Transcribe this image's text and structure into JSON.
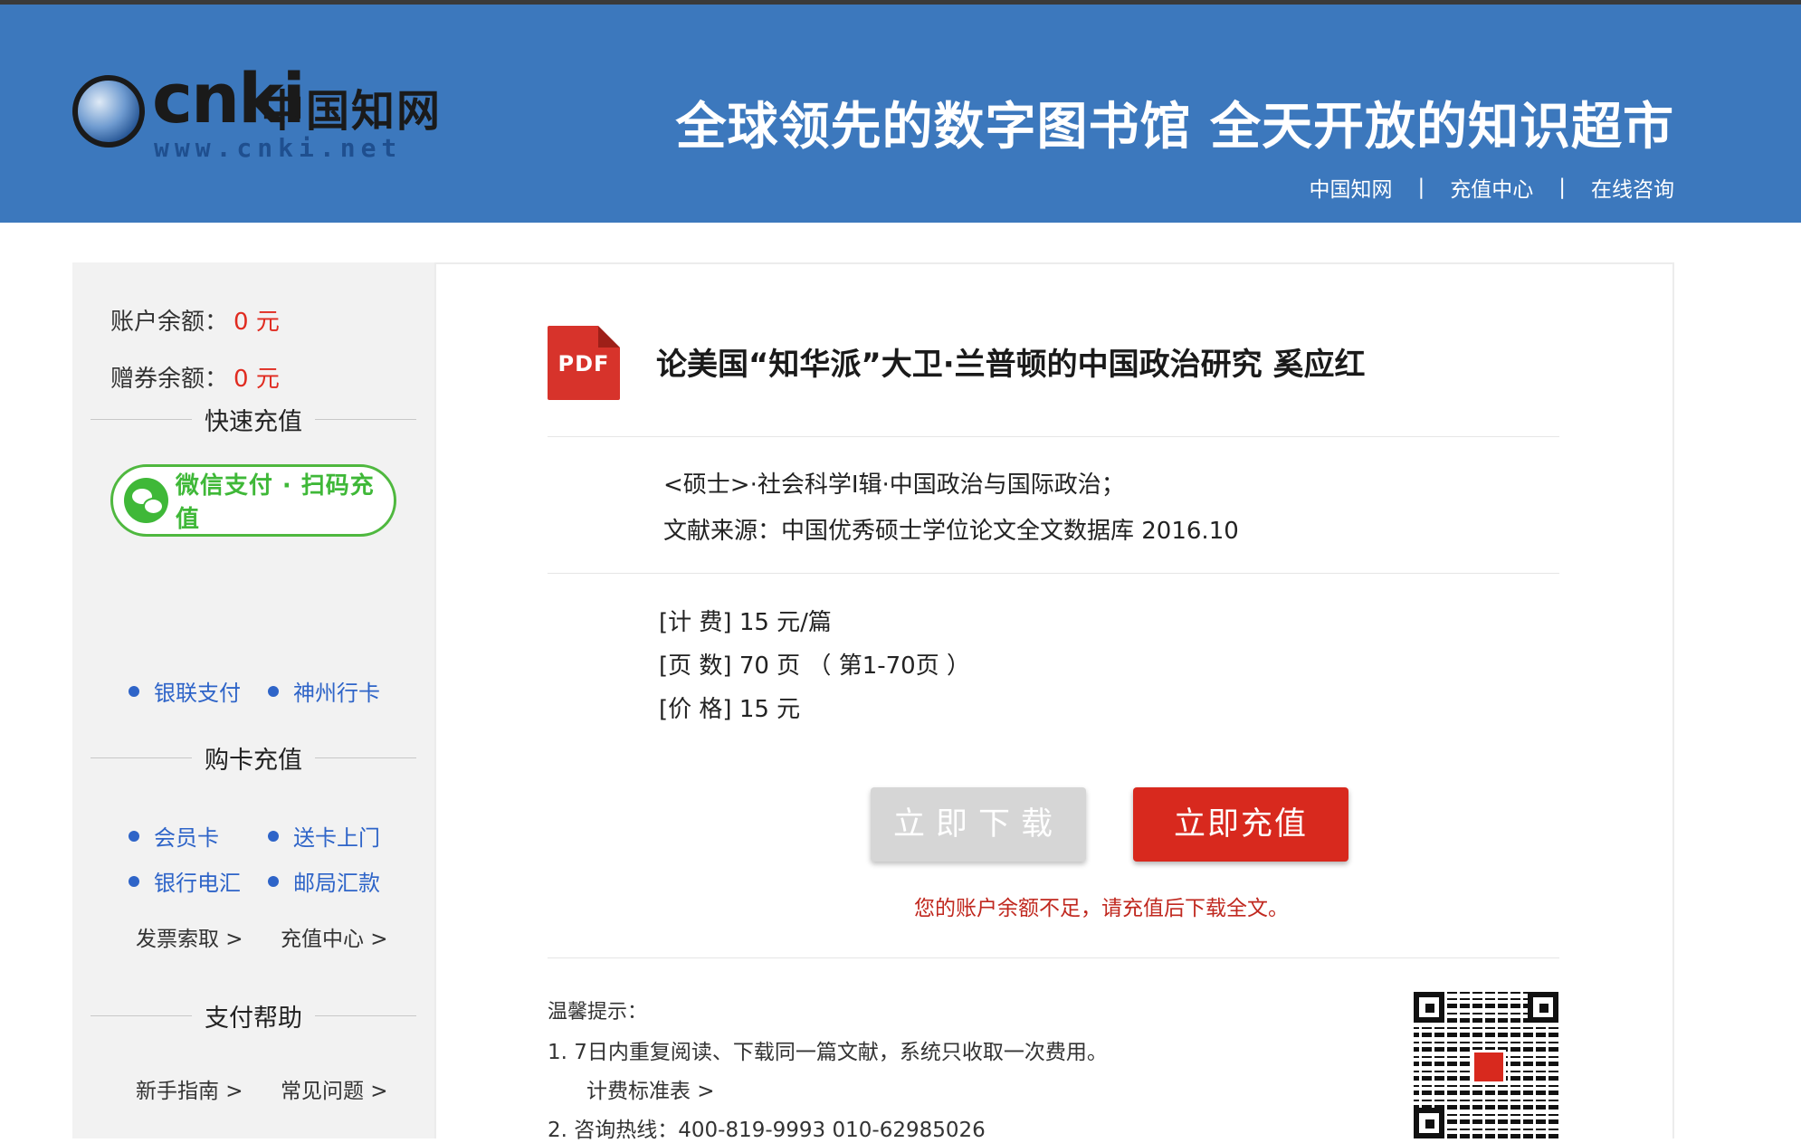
{
  "header": {
    "logo_text": "cnki",
    "logo_cn": "中国知网",
    "logo_url": "www.cnki.net",
    "slogan": "全球领先的数字图书馆 全天开放的知识超市",
    "links": [
      "中国知网",
      "充值中心",
      "在线咨询"
    ],
    "separator": "|",
    "bg_color": "#3c78bd"
  },
  "sidebar": {
    "account_balance_label": "账户余额：",
    "account_balance_value": "0 元",
    "voucher_balance_label": "赠券余额：",
    "voucher_balance_value": "0 元",
    "quick_recharge_title": "快速充值",
    "wechat_button": "微信支付 · 扫码充值",
    "quick_methods": [
      "银联支付",
      "神州行卡"
    ],
    "card_recharge_title": "购卡充值",
    "card_methods": [
      "会员卡",
      "送卡上门",
      "银行电汇",
      "邮局汇款"
    ],
    "invoice_link": "发票索取 >",
    "recharge_center_link": "充值中心 >",
    "pay_help_title": "支付帮助",
    "help_links": [
      "新手指南 >",
      "常见问题 >"
    ]
  },
  "document": {
    "icon_label": "PDF",
    "title": "论美国“知华派”大卫·兰普顿的中国政治研究 奚应红",
    "category": "<硕士>·社会科学Ⅰ辑·中国政治与国际政治；",
    "source": "文献来源：中国优秀硕士学位论文全文数据库 2016.10",
    "fee": "[计 费] 15 元/篇",
    "pages": "[页 数] 70 页 （ 第1-70页 ）",
    "price": "[价 格] 15 元"
  },
  "actions": {
    "download_button": "立即下载",
    "recharge_button": "立即充值",
    "warning": "您的账户余额不足，请充值后下载全文。"
  },
  "tips": {
    "title": "温馨提示：",
    "item1": "1.  7日内重复阅读、下载同一篇文献，系统只收取一次费用。",
    "item1_link": "计费标准表 >",
    "item2": "2.  咨询热线：400-819-9993    010-62985026"
  },
  "colors": {
    "accent_red": "#d8291e",
    "link_blue": "#2e64c8",
    "wechat_green": "#3fb838"
  }
}
